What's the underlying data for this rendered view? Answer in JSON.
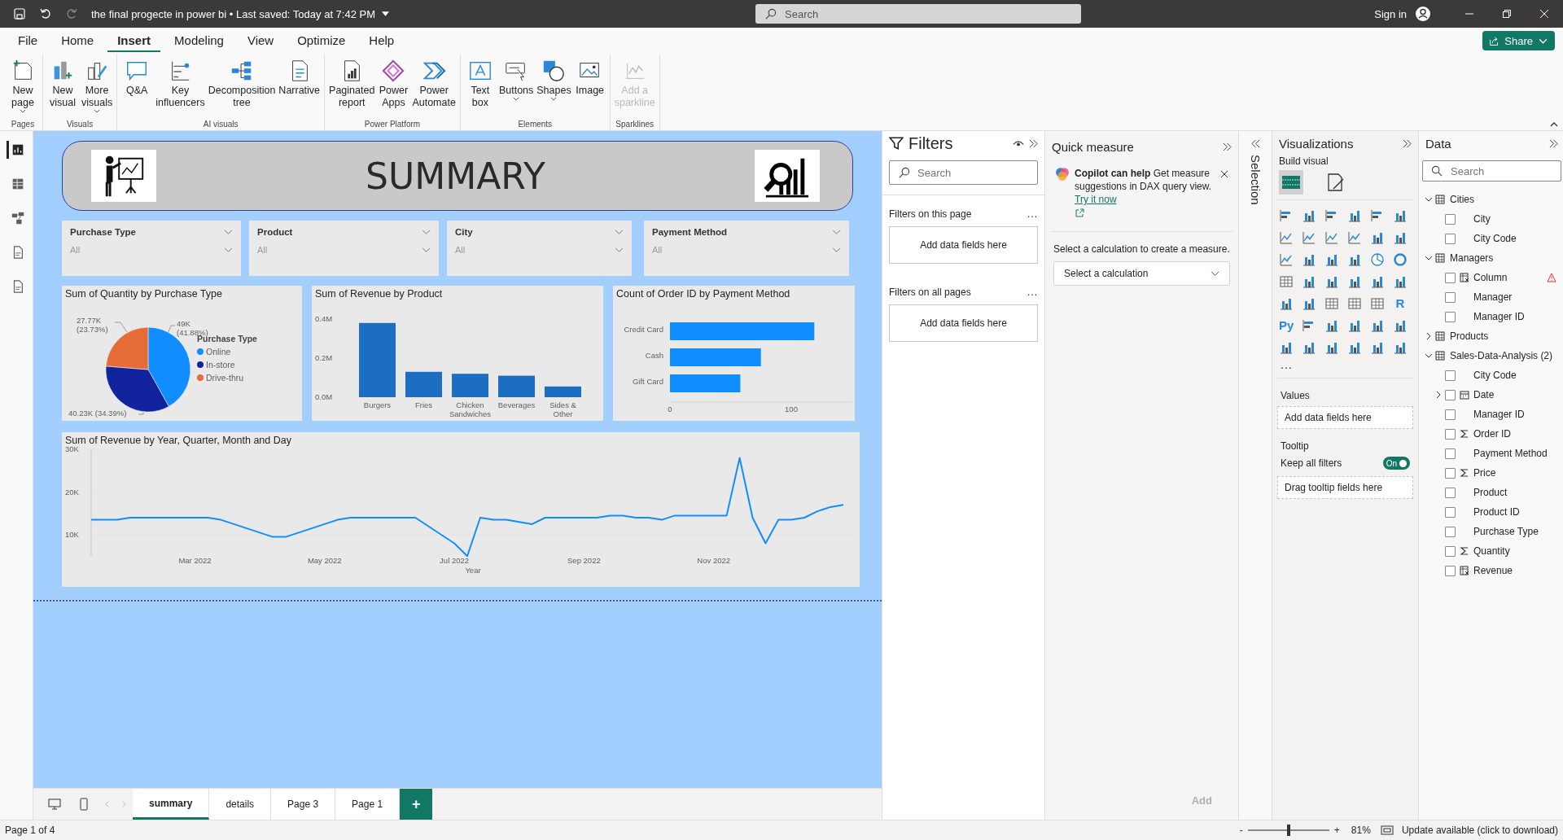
{
  "title_bar": {
    "title": "the final progecte in power bi • Last saved: Today at 7:42 PM",
    "search_placeholder": "Search",
    "sign_in": "Sign in"
  },
  "menu_tabs": [
    {
      "label": "File",
      "selected": false
    },
    {
      "label": "Home",
      "selected": false
    },
    {
      "label": "Insert",
      "selected": true
    },
    {
      "label": "Modeling",
      "selected": false
    },
    {
      "label": "View",
      "selected": false
    },
    {
      "label": "Optimize",
      "selected": false
    },
    {
      "label": "Help",
      "selected": false
    }
  ],
  "share_button": "Share",
  "ribbon_groups": [
    {
      "label": "Pages",
      "items": [
        {
          "label": "New page",
          "caret": true,
          "disabled": false
        }
      ]
    },
    {
      "label": "Visuals",
      "items": [
        {
          "label": "New visual",
          "caret": false,
          "disabled": false
        },
        {
          "label": "More visuals",
          "caret": true,
          "disabled": false
        }
      ]
    },
    {
      "label": "AI visuals",
      "items": [
        {
          "label": "Q&A",
          "caret": false,
          "disabled": false
        },
        {
          "label": "Key influencers",
          "caret": false,
          "disabled": false
        },
        {
          "label": "Decomposition tree",
          "caret": false,
          "disabled": false
        },
        {
          "label": "Narrative",
          "caret": false,
          "disabled": false
        }
      ]
    },
    {
      "label": "Power Platform",
      "items": [
        {
          "label": "Paginated report",
          "caret": false,
          "disabled": false
        },
        {
          "label": "Power Apps",
          "caret": false,
          "disabled": false
        },
        {
          "label": "Power Automate",
          "caret": false,
          "disabled": false
        }
      ]
    },
    {
      "label": "Elements",
      "items": [
        {
          "label": "Text box",
          "caret": false,
          "disabled": false
        },
        {
          "label": "Buttons",
          "caret": true,
          "disabled": false
        },
        {
          "label": "Shapes",
          "caret": true,
          "disabled": false
        },
        {
          "label": "Image",
          "caret": false,
          "disabled": false
        }
      ]
    },
    {
      "label": "Sparklines",
      "items": [
        {
          "label": "Add a sparkline",
          "caret": false,
          "disabled": true
        }
      ]
    }
  ],
  "left_views": [
    {
      "selected": true
    },
    {
      "selected": false
    },
    {
      "selected": false
    },
    {
      "selected": false
    },
    {
      "selected": false
    }
  ],
  "report": {
    "header": {
      "title": "SUMMARY"
    },
    "slicers": [
      {
        "label": "Purchase Type",
        "value": "All"
      },
      {
        "label": "Product",
        "value": "All"
      },
      {
        "label": "City",
        "value": "All"
      },
      {
        "label": "Payment Method",
        "value": "All"
      }
    ],
    "pie_visual": {
      "chart_data": {
        "type": "pie",
        "title": "Sum of Quantity by Purchase Type",
        "categories": [
          "Online",
          "In-store",
          "Drive-thru"
        ],
        "colors": [
          "#118dff",
          "#12239e",
          "#e66c37"
        ],
        "series": [
          {
            "values": [
              41.88,
              34.39,
              23.73
            ]
          }
        ],
        "value_labels": [
          "49K (41.88%)",
          "40.23K (34.39%)",
          "27.77K (23.73%)"
        ],
        "legend": {
          "title": "Purchase Type"
        }
      }
    },
    "bar_visual": {
      "chart_data": {
        "type": "bar",
        "title": "Sum of Revenue by Product",
        "categories": [
          "Burgers",
          "Fries",
          "Chicken Sandwiches",
          "Beverages",
          "Sides & Other"
        ],
        "series": [
          {
            "color": "#1b6ec2",
            "values": [
              380000,
              130000,
              120000,
              110000,
              55000
            ]
          }
        ],
        "ylim": [
          0,
          400000
        ],
        "yticks": [
          {
            "value": 0,
            "label": "0.0M"
          },
          {
            "value": 200000,
            "label": "0.2M"
          },
          {
            "value": 400000,
            "label": "0.4M"
          }
        ]
      }
    },
    "hbar_visual": {
      "chart_data": {
        "type": "bar",
        "orientation": "horizontal",
        "title": "Count of Order ID by Payment Method",
        "categories": [
          "Credit Card",
          "Cash",
          "Gift Card"
        ],
        "series": [
          {
            "color": "#118dff",
            "values": [
              119,
              75,
              58
            ]
          }
        ],
        "xlim": [
          0,
          150
        ],
        "xticks": [
          0,
          100
        ]
      }
    },
    "line_visual": {
      "chart_data": {
        "type": "line",
        "title": "Sum of Revenue by Year, Quarter, Month and Day",
        "xlabel": "Year",
        "categories": [
          null,
          null,
          null,
          null,
          null,
          null,
          null,
          null,
          "Mar 2022",
          null,
          null,
          null,
          null,
          null,
          null,
          null,
          null,
          null,
          "May 2022",
          null,
          null,
          null,
          null,
          null,
          null,
          null,
          null,
          null,
          "Jul 2022",
          null,
          null,
          null,
          null,
          null,
          null,
          null,
          null,
          null,
          "Sep 2022",
          null,
          null,
          null,
          null,
          null,
          null,
          null,
          null,
          null,
          "Nov 2022",
          null,
          null,
          null,
          null,
          null,
          null,
          null,
          null,
          null,
          null
        ],
        "series": [
          {
            "color": "#118dff",
            "values": [
              13500,
              13500,
              13500,
              14000,
              14000,
              14000,
              14000,
              14000,
              14000,
              14000,
              13500,
              12500,
              11500,
              10500,
              9500,
              9500,
              10500,
              11500,
              12500,
              13500,
              14000,
              14000,
              14000,
              14000,
              14000,
              14000,
              12000,
              10000,
              8000,
              5000,
              14000,
              13500,
              13500,
              13000,
              12500,
              14000,
              14000,
              14000,
              14000,
              14000,
              14500,
              14500,
              14000,
              14000,
              13500,
              14500,
              14500,
              14500,
              14500,
              14500,
              28000,
              14000,
              8000,
              13500,
              13500,
              14000,
              15500,
              16500,
              17000
            ]
          }
        ],
        "ylim": [
          5000,
          30000
        ],
        "yticks": [
          {
            "value": 10000,
            "label": "10K"
          },
          {
            "value": 20000,
            "label": "20K"
          },
          {
            "value": 30000,
            "label": "30K"
          }
        ]
      }
    }
  },
  "page_tabs": [
    {
      "label": "summary",
      "selected": true
    },
    {
      "label": "details",
      "selected": false
    },
    {
      "label": "Page 3",
      "selected": false
    },
    {
      "label": "Page 1",
      "selected": false
    }
  ],
  "add_page": "+",
  "filters": {
    "title": "Filters",
    "search_placeholder": "Search",
    "sections": [
      {
        "label": "Filters on this page",
        "more": "...",
        "drop": "Add data fields here"
      },
      {
        "label": "Filters on all pages",
        "more": "...",
        "drop": "Add data fields here"
      }
    ]
  },
  "quick_measure": {
    "title": "Quick measure",
    "copilot_title": "Copilot can help",
    "copilot_text": "Get measure suggestions in DAX query view.",
    "link": "Try it now",
    "prompt": "Select a calculation to create a measure.",
    "select_placeholder": "Select a calculation",
    "add_button": {
      "label": "Add",
      "disabled": true
    }
  },
  "selection_label": "Selection",
  "visualizations": {
    "title": "Visualizations",
    "build": "Build visual",
    "build_tabs": [
      {
        "selected": true
      },
      {
        "selected": false
      }
    ],
    "script_visuals": [
      "R",
      "Py"
    ],
    "more": "...",
    "values_label": "Values",
    "values_placeholder": "Add data fields here",
    "tooltip_label": "Tooltip",
    "keep_filters": "Keep all filters",
    "toggle": {
      "on": true,
      "label": "On"
    },
    "tooltip_placeholder": "Drag tooltip fields here"
  },
  "data": {
    "title": "Data",
    "search_placeholder": "Search",
    "tables": [
      {
        "name": "Cities",
        "expanded": true,
        "children": [
          {
            "name": "City",
            "kind": "field",
            "checked": false,
            "warning": false
          },
          {
            "name": "City Code",
            "kind": "field",
            "checked": false,
            "warning": false
          }
        ]
      },
      {
        "name": "Managers",
        "expanded": true,
        "children": [
          {
            "name": "Column",
            "kind": "calculated",
            "checked": false,
            "warning": true
          },
          {
            "name": "Manager",
            "kind": "field",
            "checked": false,
            "warning": false
          },
          {
            "name": "Manager ID",
            "kind": "field",
            "checked": false,
            "warning": false
          }
        ]
      },
      {
        "name": "Products",
        "expanded": false
      },
      {
        "name": "Sales-Data-Analysis (2)",
        "expanded": true,
        "children": [
          {
            "name": "City Code",
            "kind": "field",
            "checked": false,
            "warning": false
          },
          {
            "name": "Date",
            "kind": "date",
            "checked": false,
            "warning": false
          },
          {
            "name": "Manager ID",
            "kind": "field",
            "checked": false,
            "warning": false
          },
          {
            "name": "Order ID",
            "kind": "sum",
            "checked": false,
            "warning": false
          },
          {
            "name": "Payment Method",
            "kind": "field",
            "checked": false,
            "warning": false
          },
          {
            "name": "Price",
            "kind": "sum",
            "checked": false,
            "warning": false
          },
          {
            "name": "Product",
            "kind": "field",
            "checked": false,
            "warning": false
          },
          {
            "name": "Product ID",
            "kind": "field",
            "checked": false,
            "warning": false
          },
          {
            "name": "Purchase Type",
            "kind": "field",
            "checked": false,
            "warning": false
          },
          {
            "name": "Quantity",
            "kind": "sum",
            "checked": false,
            "warning": false
          },
          {
            "name": "Revenue",
            "kind": "calculated",
            "checked": false,
            "warning": false
          }
        ]
      }
    ]
  },
  "status_bar": {
    "page": "Page 1 of 4",
    "zoom_out": "-",
    "zoom_in": "+",
    "zoom": {
      "level": 0.5
    },
    "zoom_text": "81%",
    "update": "Update available (click to download)"
  }
}
